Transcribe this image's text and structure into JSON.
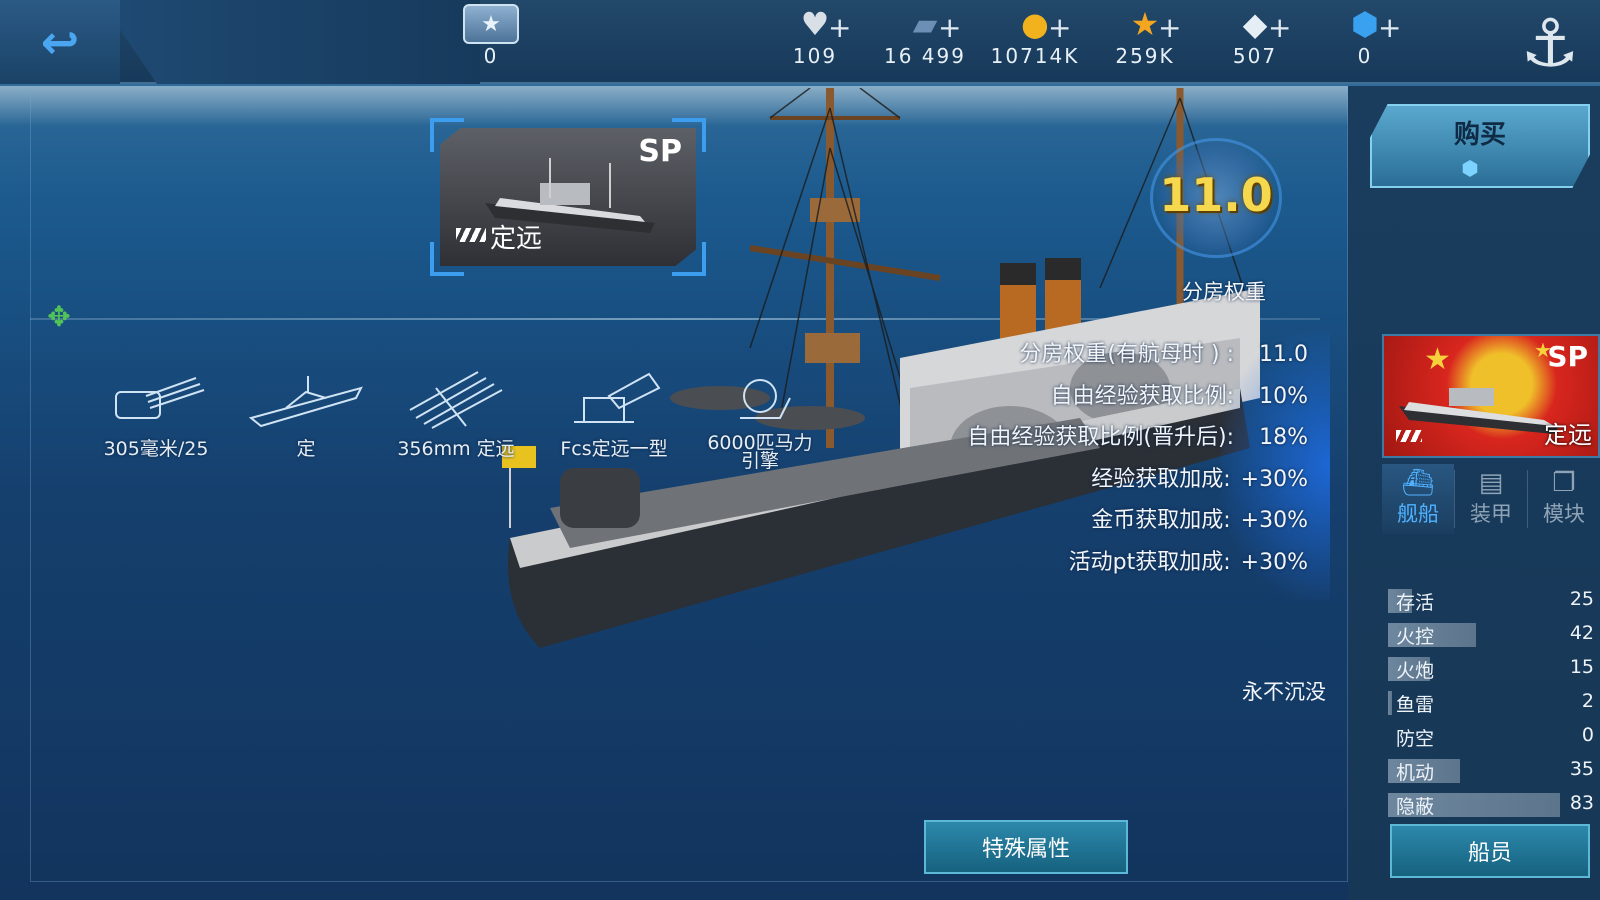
{
  "topbar": {
    "rank_value": "0",
    "resources": [
      {
        "icon": "heart-icon",
        "value": "109",
        "color": "#d9dfe6"
      },
      {
        "icon": "card-icon",
        "value": "16 499",
        "color": "#5b7fa6"
      },
      {
        "icon": "gold-coin-icon",
        "value": "10714K",
        "color": "#f2b21d"
      },
      {
        "icon": "star-icon",
        "value": "259K",
        "color": "#f4a620"
      },
      {
        "icon": "diamond-icon",
        "value": "507",
        "color": "#e6eef5"
      },
      {
        "icon": "blue-gem-icon",
        "value": "0",
        "color": "#3aa0f0"
      }
    ]
  },
  "ship_card": {
    "badge": "SP",
    "name": "定远"
  },
  "weapons": [
    {
      "icon": "main-gun-icon",
      "label": "305毫米/25"
    },
    {
      "icon": "hull-icon",
      "label": "定"
    },
    {
      "icon": "torpedo-icon",
      "label": "356mm 定远"
    },
    {
      "icon": "fire-control-icon",
      "label": "Fcs定远一型"
    },
    {
      "icon": "engine-icon",
      "label": "6000匹马力引擎"
    }
  ],
  "rating": {
    "value": "11.0",
    "title": "分房权重"
  },
  "attributes": [
    {
      "label": "分房权重(有航母时 ) :",
      "value": "11.0"
    },
    {
      "label": "自由经验获取比例:",
      "value": "10%"
    },
    {
      "label": "自由经验获取比例(晋升后):",
      "value": "18%"
    },
    {
      "label": "经验获取加成:",
      "value": "+30%"
    },
    {
      "label": "金币获取加成:",
      "value": "+30%"
    },
    {
      "label": "活动pt获取加成:",
      "value": "+30%"
    }
  ],
  "special_note": "永不沉没",
  "special_button": "特殊属性",
  "right_panel": {
    "buy_label": "购买",
    "portrait_badge": "SP",
    "portrait_name": "定远",
    "tabs": [
      {
        "icon": "ship-icon",
        "label": "舰船",
        "active": true
      },
      {
        "icon": "armor-icon",
        "label": "装甲",
        "active": false
      },
      {
        "icon": "module-icon",
        "label": "模块",
        "active": false
      }
    ],
    "stats": [
      {
        "label": "存活",
        "value": "25"
      },
      {
        "label": "火控",
        "value": "42"
      },
      {
        "label": "火炮",
        "value": "15"
      },
      {
        "label": "鱼雷",
        "value": "2"
      },
      {
        "label": "防空",
        "value": "0"
      },
      {
        "label": "机动",
        "value": "35"
      },
      {
        "label": "隐蔽",
        "value": "83"
      }
    ],
    "crew_button": "船员"
  },
  "colors": {
    "accent_blue": "#3d9ef0",
    "rating_gold": "#f5d84d",
    "button_teal": "#1f7595"
  }
}
